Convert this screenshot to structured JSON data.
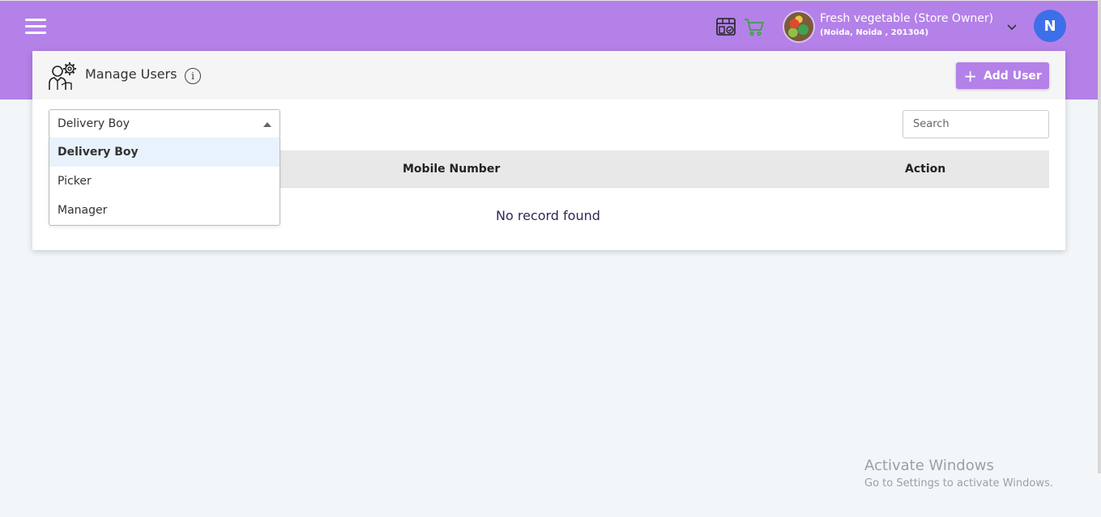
{
  "header": {
    "store_name": "Fresh vegetable (Store Owner)",
    "store_address": "(Noida, Noida , 201304)",
    "user_initial": "N",
    "brand_color": "#b481e8"
  },
  "page": {
    "title": "Manage Users",
    "info_glyph": "i",
    "add_button_label": "Add User",
    "add_button_icon": "plus-icon"
  },
  "filters": {
    "role_selected": "Delivery Boy",
    "role_options": [
      "Delivery Boy",
      "Picker",
      "Manager"
    ],
    "search_placeholder": "Search"
  },
  "table": {
    "columns": [
      "Mobile Number",
      "Action"
    ],
    "empty_message": "No record found"
  },
  "watermark": {
    "title": "Activate Windows",
    "subtitle": "Go to Settings to activate Windows."
  }
}
